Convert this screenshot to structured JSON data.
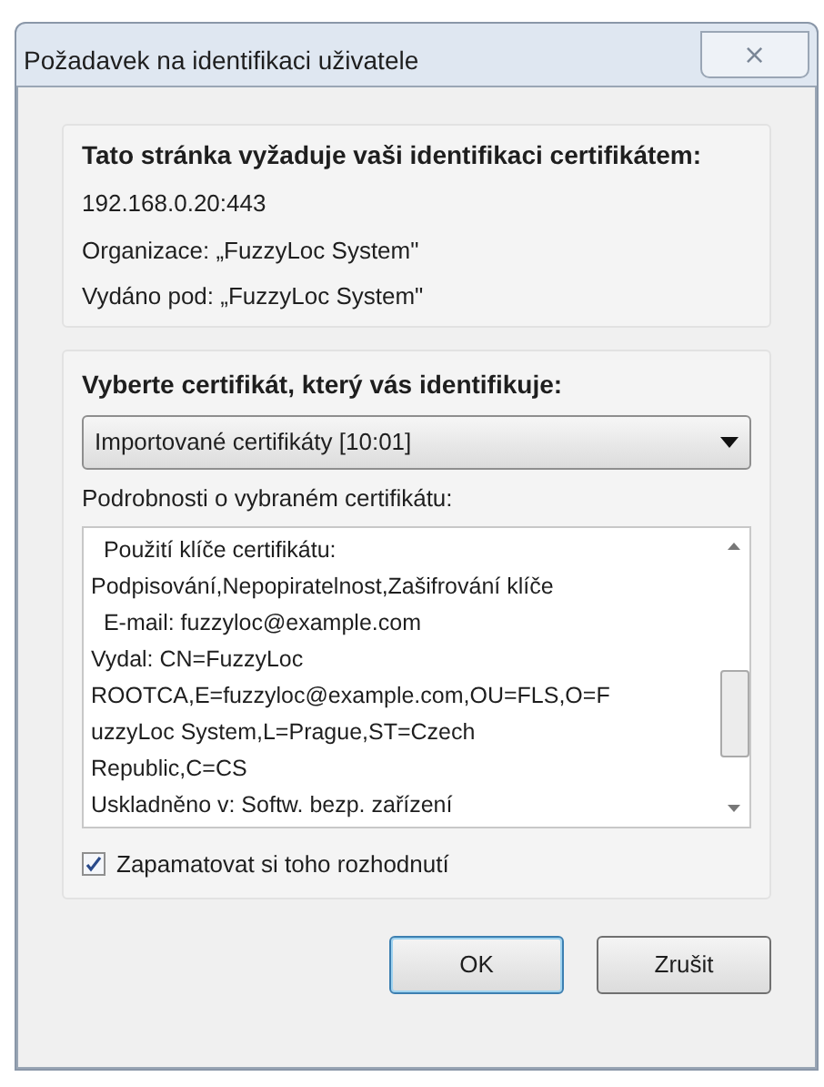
{
  "window": {
    "title": "Požadavek na identifikaci uživatele",
    "close": "⨯"
  },
  "site_group": {
    "heading": "Tato stránka vyžaduje vaši identifikaci certifikátem:",
    "lines": [
      "192.168.0.20:443",
      "Organizace: „FuzzyLoc System\"",
      "Vydáno pod: „FuzzyLoc System\""
    ]
  },
  "cert_group": {
    "heading": "Vyberte certifikát, který vás identifikuje:",
    "select": {
      "value": "Importované certifikáty [10:01]"
    },
    "details_label": "Podrobnosti o vybraném certifikátu:",
    "details": [
      "  Použití klíče certifikátu:",
      "Podpisování,Nepopiratelnost,Zašifrování klíče",
      "  E-mail: fuzzyloc@example.com",
      "Vydal: CN=FuzzyLoc",
      "ROOTCA,E=fuzzyloc@example.com,OU=FLS,O=F",
      "uzzyLoc System,L=Prague,ST=Czech",
      "Republic,C=CS",
      "Uskladněno v: Softw. bezp. zařízení"
    ],
    "remember": {
      "label": "Zapamatovat si toho rozhodnutí",
      "checked": true
    }
  },
  "buttons": [
    {
      "label": "OK",
      "default": true
    },
    {
      "label": "Zrušit",
      "default": false
    }
  ]
}
